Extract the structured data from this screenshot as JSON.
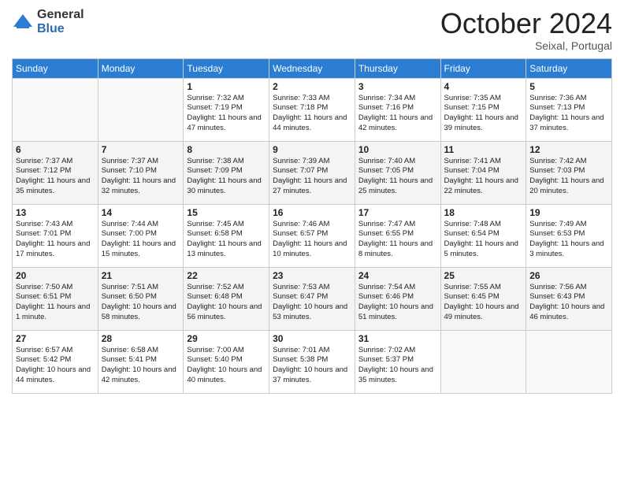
{
  "logo": {
    "general": "General",
    "blue": "Blue"
  },
  "header": {
    "month": "October 2024",
    "location": "Seixal, Portugal"
  },
  "weekdays": [
    "Sunday",
    "Monday",
    "Tuesday",
    "Wednesday",
    "Thursday",
    "Friday",
    "Saturday"
  ],
  "weeks": [
    [
      {
        "day": "",
        "sunrise": "",
        "sunset": "",
        "daylight": ""
      },
      {
        "day": "",
        "sunrise": "",
        "sunset": "",
        "daylight": ""
      },
      {
        "day": "1",
        "sunrise": "Sunrise: 7:32 AM",
        "sunset": "Sunset: 7:19 PM",
        "daylight": "Daylight: 11 hours and 47 minutes."
      },
      {
        "day": "2",
        "sunrise": "Sunrise: 7:33 AM",
        "sunset": "Sunset: 7:18 PM",
        "daylight": "Daylight: 11 hours and 44 minutes."
      },
      {
        "day": "3",
        "sunrise": "Sunrise: 7:34 AM",
        "sunset": "Sunset: 7:16 PM",
        "daylight": "Daylight: 11 hours and 42 minutes."
      },
      {
        "day": "4",
        "sunrise": "Sunrise: 7:35 AM",
        "sunset": "Sunset: 7:15 PM",
        "daylight": "Daylight: 11 hours and 39 minutes."
      },
      {
        "day": "5",
        "sunrise": "Sunrise: 7:36 AM",
        "sunset": "Sunset: 7:13 PM",
        "daylight": "Daylight: 11 hours and 37 minutes."
      }
    ],
    [
      {
        "day": "6",
        "sunrise": "Sunrise: 7:37 AM",
        "sunset": "Sunset: 7:12 PM",
        "daylight": "Daylight: 11 hours and 35 minutes."
      },
      {
        "day": "7",
        "sunrise": "Sunrise: 7:37 AM",
        "sunset": "Sunset: 7:10 PM",
        "daylight": "Daylight: 11 hours and 32 minutes."
      },
      {
        "day": "8",
        "sunrise": "Sunrise: 7:38 AM",
        "sunset": "Sunset: 7:09 PM",
        "daylight": "Daylight: 11 hours and 30 minutes."
      },
      {
        "day": "9",
        "sunrise": "Sunrise: 7:39 AM",
        "sunset": "Sunset: 7:07 PM",
        "daylight": "Daylight: 11 hours and 27 minutes."
      },
      {
        "day": "10",
        "sunrise": "Sunrise: 7:40 AM",
        "sunset": "Sunset: 7:05 PM",
        "daylight": "Daylight: 11 hours and 25 minutes."
      },
      {
        "day": "11",
        "sunrise": "Sunrise: 7:41 AM",
        "sunset": "Sunset: 7:04 PM",
        "daylight": "Daylight: 11 hours and 22 minutes."
      },
      {
        "day": "12",
        "sunrise": "Sunrise: 7:42 AM",
        "sunset": "Sunset: 7:03 PM",
        "daylight": "Daylight: 11 hours and 20 minutes."
      }
    ],
    [
      {
        "day": "13",
        "sunrise": "Sunrise: 7:43 AM",
        "sunset": "Sunset: 7:01 PM",
        "daylight": "Daylight: 11 hours and 17 minutes."
      },
      {
        "day": "14",
        "sunrise": "Sunrise: 7:44 AM",
        "sunset": "Sunset: 7:00 PM",
        "daylight": "Daylight: 11 hours and 15 minutes."
      },
      {
        "day": "15",
        "sunrise": "Sunrise: 7:45 AM",
        "sunset": "Sunset: 6:58 PM",
        "daylight": "Daylight: 11 hours and 13 minutes."
      },
      {
        "day": "16",
        "sunrise": "Sunrise: 7:46 AM",
        "sunset": "Sunset: 6:57 PM",
        "daylight": "Daylight: 11 hours and 10 minutes."
      },
      {
        "day": "17",
        "sunrise": "Sunrise: 7:47 AM",
        "sunset": "Sunset: 6:55 PM",
        "daylight": "Daylight: 11 hours and 8 minutes."
      },
      {
        "day": "18",
        "sunrise": "Sunrise: 7:48 AM",
        "sunset": "Sunset: 6:54 PM",
        "daylight": "Daylight: 11 hours and 5 minutes."
      },
      {
        "day": "19",
        "sunrise": "Sunrise: 7:49 AM",
        "sunset": "Sunset: 6:53 PM",
        "daylight": "Daylight: 11 hours and 3 minutes."
      }
    ],
    [
      {
        "day": "20",
        "sunrise": "Sunrise: 7:50 AM",
        "sunset": "Sunset: 6:51 PM",
        "daylight": "Daylight: 11 hours and 1 minute."
      },
      {
        "day": "21",
        "sunrise": "Sunrise: 7:51 AM",
        "sunset": "Sunset: 6:50 PM",
        "daylight": "Daylight: 10 hours and 58 minutes."
      },
      {
        "day": "22",
        "sunrise": "Sunrise: 7:52 AM",
        "sunset": "Sunset: 6:48 PM",
        "daylight": "Daylight: 10 hours and 56 minutes."
      },
      {
        "day": "23",
        "sunrise": "Sunrise: 7:53 AM",
        "sunset": "Sunset: 6:47 PM",
        "daylight": "Daylight: 10 hours and 53 minutes."
      },
      {
        "day": "24",
        "sunrise": "Sunrise: 7:54 AM",
        "sunset": "Sunset: 6:46 PM",
        "daylight": "Daylight: 10 hours and 51 minutes."
      },
      {
        "day": "25",
        "sunrise": "Sunrise: 7:55 AM",
        "sunset": "Sunset: 6:45 PM",
        "daylight": "Daylight: 10 hours and 49 minutes."
      },
      {
        "day": "26",
        "sunrise": "Sunrise: 7:56 AM",
        "sunset": "Sunset: 6:43 PM",
        "daylight": "Daylight: 10 hours and 46 minutes."
      }
    ],
    [
      {
        "day": "27",
        "sunrise": "Sunrise: 6:57 AM",
        "sunset": "Sunset: 5:42 PM",
        "daylight": "Daylight: 10 hours and 44 minutes."
      },
      {
        "day": "28",
        "sunrise": "Sunrise: 6:58 AM",
        "sunset": "Sunset: 5:41 PM",
        "daylight": "Daylight: 10 hours and 42 minutes."
      },
      {
        "day": "29",
        "sunrise": "Sunrise: 7:00 AM",
        "sunset": "Sunset: 5:40 PM",
        "daylight": "Daylight: 10 hours and 40 minutes."
      },
      {
        "day": "30",
        "sunrise": "Sunrise: 7:01 AM",
        "sunset": "Sunset: 5:38 PM",
        "daylight": "Daylight: 10 hours and 37 minutes."
      },
      {
        "day": "31",
        "sunrise": "Sunrise: 7:02 AM",
        "sunset": "Sunset: 5:37 PM",
        "daylight": "Daylight: 10 hours and 35 minutes."
      },
      {
        "day": "",
        "sunrise": "",
        "sunset": "",
        "daylight": ""
      },
      {
        "day": "",
        "sunrise": "",
        "sunset": "",
        "daylight": ""
      }
    ]
  ]
}
